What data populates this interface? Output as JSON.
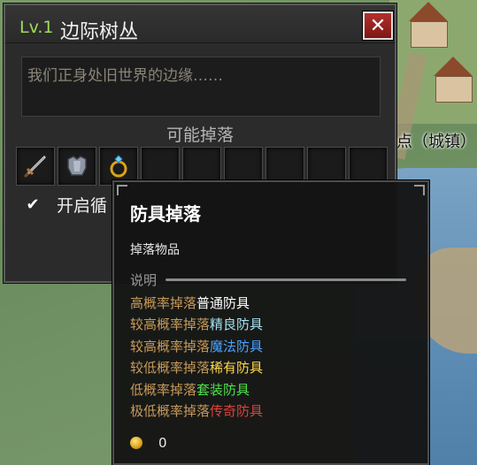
{
  "map": {
    "town_label": "点（城镇）"
  },
  "panel": {
    "level": "Lv.1",
    "title": "边际树丛",
    "close_glyph": "✕",
    "description": "我们正身处旧世界的边缘……",
    "drops_title": "可能掉落",
    "slots": [
      {
        "icon": "sword-icon"
      },
      {
        "icon": "armor-icon"
      },
      {
        "icon": "ring-icon"
      },
      {
        "icon": ""
      },
      {
        "icon": ""
      },
      {
        "icon": ""
      },
      {
        "icon": ""
      },
      {
        "icon": ""
      },
      {
        "icon": ""
      }
    ],
    "loop_checked": true,
    "loop_label": "开启循"
  },
  "tooltip": {
    "title": "防具掉落",
    "subtitle": "掉落物品",
    "explain_label": "说明",
    "lines": [
      {
        "prefix": "高概率掉落",
        "item": "普通防具",
        "color": "#ffffff"
      },
      {
        "prefix": "较高概率掉落",
        "item": "精良防具",
        "color": "#a6e3f2"
      },
      {
        "prefix": "较高概率掉落",
        "item": "魔法防具",
        "color": "#4aa3ff"
      },
      {
        "prefix": "较低概率掉落",
        "item": "稀有防具",
        "color": "#ffd84a"
      },
      {
        "prefix": "低概率掉落",
        "item": "套装防具",
        "color": "#4fe04a"
      },
      {
        "prefix": "极低概率掉落",
        "item": "传奇防具",
        "color": "#e0403a"
      }
    ],
    "money": "0"
  }
}
